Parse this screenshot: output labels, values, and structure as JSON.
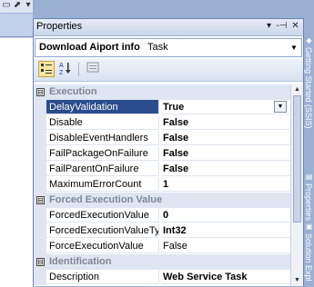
{
  "window": {
    "title": "Properties",
    "buttons": [
      "▾",
      "-⊣",
      "✕"
    ]
  },
  "object_selector": {
    "name": "Download Aiport info",
    "type": "Task",
    "dropdown": "▼"
  },
  "toolbar": {
    "categorized_icon": "categorized-icon",
    "alphabetical_icon": "alphabetical-icon",
    "property_pages_icon": "property-pages-icon"
  },
  "categories": [
    {
      "label": "Execution",
      "toggle": "⊟",
      "properties": [
        {
          "name": "DelayValidation",
          "value": "True",
          "bold": true,
          "selected": true
        },
        {
          "name": "Disable",
          "value": "False",
          "bold": true
        },
        {
          "name": "DisableEventHandlers",
          "value": "False",
          "bold": true
        },
        {
          "name": "FailPackageOnFailure",
          "value": "False",
          "bold": true
        },
        {
          "name": "FailParentOnFailure",
          "value": "False",
          "bold": true
        },
        {
          "name": "MaximumErrorCount",
          "value": "1",
          "bold": true
        }
      ]
    },
    {
      "label": "Forced Execution Value",
      "toggle": "⊟",
      "properties": [
        {
          "name": "ForcedExecutionValue",
          "value": "0",
          "bold": true
        },
        {
          "name": "ForcedExecutionValueTyp",
          "value": "Int32",
          "bold": true
        },
        {
          "name": "ForceExecutionValue",
          "value": "False",
          "bold": false
        }
      ]
    },
    {
      "label": "Identification",
      "toggle": "⊟",
      "properties": [
        {
          "name": "Description",
          "value": "Web Service Task",
          "bold": true
        }
      ]
    }
  ],
  "side_tabs": [
    {
      "label": "Getting Started (SSIS)"
    },
    {
      "label": "Properties"
    },
    {
      "label": "Solution Expl"
    }
  ],
  "colors": {
    "selection": "#2b4d8d",
    "category_band": "#dfe6f1"
  }
}
